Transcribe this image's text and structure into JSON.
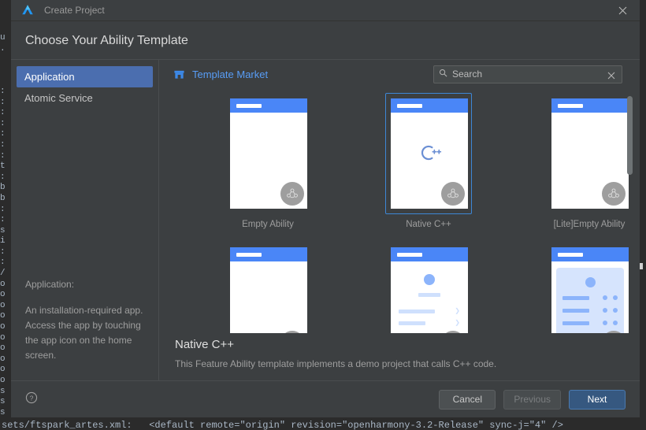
{
  "background": {
    "left_strip_text": "u\n.\n\n\n\n:\n:\n:\n:\n:\n:\n:\nt\n:\nb\nb\n:\n:\ns\ni\n:\n:\n/\no\no\no\no\no\no\no\no\no\no\ns\ns\ns\nsets/",
    "bottom_strip_text": "sets/ftspark_artes.xml:   <default remote=\"origin\" revision=\"openharmony-3.2-Release\" sync-j=\"4\" />"
  },
  "titlebar": {
    "title": "Create Project",
    "logo_icon": "devtools-logo-icon",
    "close_icon": "close-icon"
  },
  "heading": "Choose Your Ability Template",
  "sidebar": {
    "items": [
      {
        "label": "Application",
        "selected": true
      },
      {
        "label": "Atomic Service",
        "selected": false
      }
    ],
    "description_title": "Application:",
    "description_body": "An installation-required app. Access the app by touching the app icon on the home screen."
  },
  "market": {
    "label": "Template Market",
    "icon": "template-market-icon"
  },
  "search": {
    "placeholder": "Search",
    "value": "",
    "search_icon": "search-icon",
    "clear_icon": "clear-icon"
  },
  "templates": [
    {
      "label": "Empty Ability",
      "selected": false,
      "art": "blank"
    },
    {
      "label": "Native C++",
      "selected": true,
      "art": "cpp"
    },
    {
      "label": "[Lite]Empty Ability",
      "selected": false,
      "art": "blank"
    },
    {
      "label": "",
      "selected": false,
      "art": "blank"
    },
    {
      "label": "",
      "selected": false,
      "art": "list"
    },
    {
      "label": "",
      "selected": false,
      "art": "card"
    }
  ],
  "detail": {
    "title": "Native C++",
    "description": "This Feature Ability template implements a demo project that calls C++ code."
  },
  "footer": {
    "help_icon": "help-circle-icon",
    "cancel_label": "Cancel",
    "previous_label": "Previous",
    "next_label": "Next"
  },
  "colors": {
    "accent_blue": "#4b6eaf",
    "link_blue": "#589df6",
    "primary_button": "#365880",
    "selection_border": "#3d87d6",
    "dialog_bg": "#3c3f41"
  },
  "scroll": {
    "thumb_label": "templates-scrollbar"
  }
}
